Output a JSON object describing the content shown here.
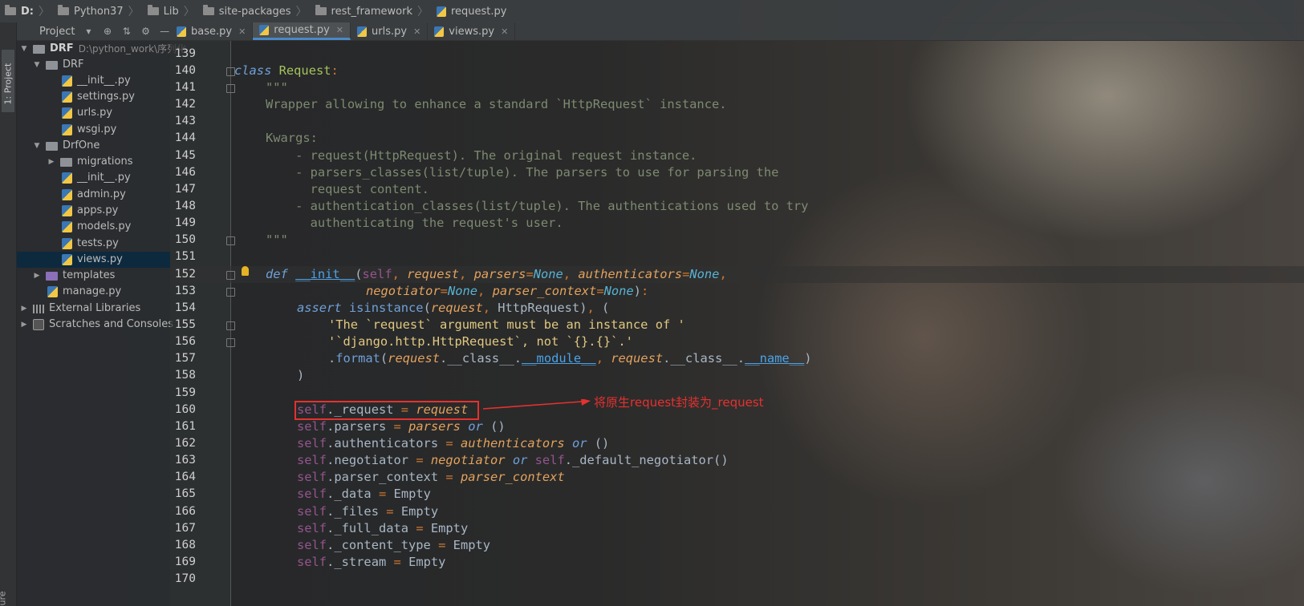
{
  "breadcrumb": [
    "D:",
    "Python37",
    "Lib",
    "site-packages",
    "rest_framework",
    "request.py"
  ],
  "tool_window": {
    "project_tab": "1: Project",
    "bottom_tab": "ure"
  },
  "project_panel": {
    "title": "Project",
    "tree": [
      {
        "label": "DRF",
        "detail": "D:\\python_work\\序列化",
        "type": "root"
      },
      {
        "label": "DRF",
        "type": "folder"
      },
      {
        "label": "__init__.py",
        "type": "py"
      },
      {
        "label": "settings.py",
        "type": "py"
      },
      {
        "label": "urls.py",
        "type": "py"
      },
      {
        "label": "wsgi.py",
        "type": "py"
      },
      {
        "label": "DrfOne",
        "type": "folder"
      },
      {
        "label": "migrations",
        "type": "folder"
      },
      {
        "label": "__init__.py",
        "type": "py"
      },
      {
        "label": "admin.py",
        "type": "py"
      },
      {
        "label": "apps.py",
        "type": "py"
      },
      {
        "label": "models.py",
        "type": "py"
      },
      {
        "label": "tests.py",
        "type": "py"
      },
      {
        "label": "views.py",
        "type": "py",
        "selected": true
      },
      {
        "label": "templates",
        "type": "folder-purple"
      },
      {
        "label": "manage.py",
        "type": "py"
      },
      {
        "label": "External Libraries",
        "type": "lib"
      },
      {
        "label": "Scratches and Consoles",
        "type": "scratch"
      }
    ]
  },
  "tabs": [
    {
      "label": "base.py",
      "active": false
    },
    {
      "label": "request.py",
      "active": true
    },
    {
      "label": "urls.py",
      "active": false
    },
    {
      "label": "views.py",
      "active": false
    }
  ],
  "editor": {
    "line_numbers": [
      "139",
      "140",
      "141",
      "142",
      "143",
      "144",
      "145",
      "146",
      "147",
      "148",
      "149",
      "150",
      "151",
      "152",
      "153",
      "154",
      "155",
      "156",
      "157",
      "158",
      "159",
      "160",
      "161",
      "162",
      "163",
      "164",
      "165",
      "166",
      "167",
      "168",
      "169",
      "170"
    ],
    "current_line": "152",
    "annotation": "将原生request封装为_request",
    "code": {
      "l140": [
        "class",
        " ",
        "Request",
        ":"
      ],
      "l141": "\"\"\"",
      "l142": "Wrapper allowing to enhance a standard `HttpRequest` instance.",
      "l144": "Kwargs:",
      "l145": "    - request(HttpRequest). The original request instance.",
      "l146": "    - parsers_classes(list/tuple). The parsers to use for parsing the",
      "l147": "      request content.",
      "l148": "    - authentication_classes(list/tuple). The authentications used to try",
      "l149": "      authenticating the request's user.",
      "l150": "\"\"\"",
      "l152": {
        "def": "def",
        "name": "__init__",
        "self": "self",
        "p1": "request",
        "p2": "parsers",
        "p3": "authenticators",
        "none": "None"
      },
      "l153": {
        "p4": "negotiator",
        "p5": "parser_context",
        "none": "None"
      },
      "l154": {
        "assert": "assert",
        "fn": "isinstance",
        "arg": "request",
        "cls": "HttpRequest"
      },
      "l155": "'The `request` argument must be an instance of '",
      "l156": "'`django.http.HttpRequest`, not `{}.{}`.'",
      "l157": {
        "method": "format",
        "arg": "request",
        "a1": "__class__",
        "a2": "__module__",
        "a3": "__name__"
      },
      "l158": ")",
      "l160": {
        "self": "self",
        "attr": "_request",
        "val": "request"
      },
      "l161": {
        "self": "self",
        "attr": "parsers",
        "val": "parsers",
        "or": "or",
        "rest": "()"
      },
      "l162": {
        "self": "self",
        "attr": "authenticators",
        "val": "authenticators",
        "or": "or",
        "rest": "()"
      },
      "l163": {
        "self": "self",
        "attr": "negotiator",
        "val": "negotiator",
        "or": "or",
        "rest": "._default_negotiator()"
      },
      "l164": {
        "self": "self",
        "attr": "parser_context",
        "val": "parser_context"
      },
      "l165": {
        "self": "self",
        "attr": "_data",
        "val": "Empty"
      },
      "l166": {
        "self": "self",
        "attr": "_files",
        "val": "Empty"
      },
      "l167": {
        "self": "self",
        "attr": "_full_data",
        "val": "Empty"
      },
      "l168": {
        "self": "self",
        "attr": "_content_type",
        "val": "Empty"
      },
      "l169": {
        "self": "self",
        "attr": "_stream",
        "val": "Empty"
      }
    }
  },
  "colors": {
    "accent": "#4a88c7",
    "annotation": "#e5312f",
    "selection": "#0d293e"
  }
}
